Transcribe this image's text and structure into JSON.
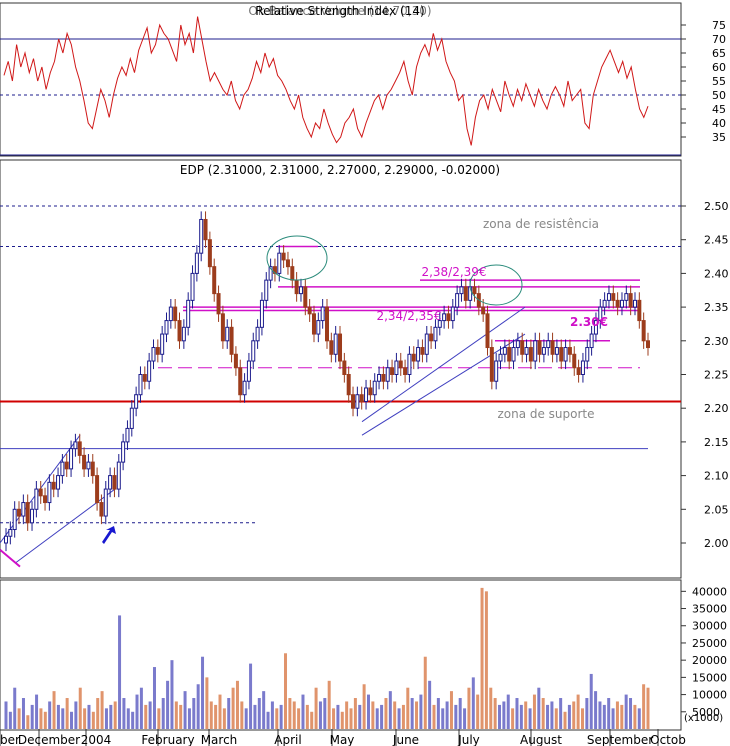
{
  "chart_data": [
    {
      "type": "line",
      "panel": "rsi",
      "title": "Relative Strength Index (14)",
      "overlap_title": "Ok Balance Volume (14,70,30)",
      "ylim": [
        30,
        80
      ],
      "yticks": [
        35,
        40,
        45,
        50,
        55,
        60,
        65,
        70,
        75
      ],
      "levels": {
        "upper": 70,
        "lower": 30,
        "mid": 50
      },
      "color": "#d01818",
      "series": [
        {
          "values": [
            57,
            62,
            55,
            68,
            60,
            65,
            58,
            63,
            55,
            60,
            52,
            58,
            62,
            70,
            65,
            72,
            68,
            60,
            55,
            48,
            40,
            38,
            45,
            52,
            48,
            42,
            50,
            56,
            60,
            57,
            63,
            58,
            66,
            70,
            74,
            65,
            68,
            75,
            72,
            70,
            66,
            62,
            75,
            68,
            72,
            65,
            78,
            70,
            62,
            55,
            58,
            55,
            52,
            50,
            55,
            48,
            45,
            50,
            52,
            56,
            62,
            58,
            65,
            60,
            63,
            57,
            55,
            52,
            48,
            45,
            50,
            42,
            38,
            35,
            40,
            38,
            45,
            40,
            36,
            33,
            35,
            40,
            42,
            45,
            38,
            35,
            40,
            44,
            48,
            50,
            45,
            50,
            52,
            55,
            58,
            62,
            55,
            50,
            60,
            65,
            68,
            64,
            72,
            66,
            70,
            62,
            58,
            55,
            48,
            50,
            38,
            32,
            42,
            48,
            50,
            45,
            52,
            48,
            44,
            55,
            50,
            46,
            52,
            48,
            54,
            50,
            46,
            52,
            48,
            45,
            50,
            53,
            50,
            46,
            55,
            48,
            50,
            52,
            40,
            38,
            50,
            55,
            60,
            63,
            66,
            62,
            58,
            62,
            56,
            60,
            52,
            45,
            42,
            46
          ]
        }
      ]
    },
    {
      "type": "candlestick",
      "panel": "price",
      "title": "EDP (2.31000, 2.31000, 2.27000, 2.29000, -0.02000)",
      "ylim": [
        1.94,
        2.56
      ],
      "yticks": [
        "2.00",
        "2.05",
        "2.10",
        "2.15",
        "2.20",
        "2.25",
        "2.30",
        "2.35",
        "2.40",
        "2.45",
        "2.50"
      ],
      "close": [
        2.01,
        2.02,
        2.05,
        2.04,
        2.06,
        2.03,
        2.05,
        2.08,
        2.07,
        2.06,
        2.09,
        2.08,
        2.1,
        2.12,
        2.11,
        2.14,
        2.15,
        2.13,
        2.11,
        2.12,
        2.1,
        2.06,
        2.04,
        2.08,
        2.1,
        2.08,
        2.12,
        2.15,
        2.17,
        2.2,
        2.22,
        2.25,
        2.24,
        2.27,
        2.29,
        2.28,
        2.31,
        2.33,
        2.35,
        2.33,
        2.3,
        2.32,
        2.36,
        2.4,
        2.43,
        2.48,
        2.45,
        2.41,
        2.37,
        2.34,
        2.3,
        2.32,
        2.28,
        2.26,
        2.22,
        2.24,
        2.27,
        2.3,
        2.32,
        2.36,
        2.39,
        2.41,
        2.4,
        2.43,
        2.42,
        2.41,
        2.39,
        2.37,
        2.38,
        2.35,
        2.34,
        2.31,
        2.33,
        2.35,
        2.3,
        2.28,
        2.31,
        2.27,
        2.25,
        2.22,
        2.2,
        2.22,
        2.21,
        2.23,
        2.22,
        2.24,
        2.25,
        2.24,
        2.26,
        2.25,
        2.27,
        2.26,
        2.25,
        2.28,
        2.27,
        2.29,
        2.28,
        2.31,
        2.3,
        2.32,
        2.33,
        2.34,
        2.33,
        2.35,
        2.37,
        2.38,
        2.36,
        2.38,
        2.37,
        2.35,
        2.34,
        2.29,
        2.24,
        2.27,
        2.28,
        2.29,
        2.27,
        2.29,
        2.3,
        2.28,
        2.29,
        2.27,
        2.3,
        2.28,
        2.29,
        2.3,
        2.28,
        2.29,
        2.27,
        2.29,
        2.28,
        2.26,
        2.25,
        2.27,
        2.29,
        2.31,
        2.33,
        2.35,
        2.36,
        2.37,
        2.36,
        2.35,
        2.36,
        2.37,
        2.35,
        2.36,
        2.33,
        2.3,
        2.29
      ],
      "color_up": "#1c1c8c",
      "color_down": "#9c3c1c",
      "annotations": [
        {
          "text": "zona de resistência",
          "color": "#888888"
        },
        {
          "text": "2,38/2,39€",
          "color": "#d010c8"
        },
        {
          "text": "2,34/2,35€",
          "color": "#d010c8"
        },
        {
          "text": "2.30€",
          "color": "#d010c8"
        },
        {
          "text": "zona de suporte",
          "color": "#888888"
        }
      ],
      "levels": [
        {
          "y": 2.5,
          "style": "dashed",
          "color": "#1c1c8c"
        },
        {
          "y": 2.44,
          "style": "dashed",
          "color": "#1c1c8c"
        },
        {
          "y": 2.21,
          "style": "solid",
          "color": "#d00000"
        },
        {
          "y": 2.14,
          "style": "solid",
          "color": "#4040c0"
        },
        {
          "y": 2.26,
          "style": "dashed",
          "color": "#d010c8"
        },
        {
          "y": 2.03,
          "style": "dotted",
          "color": "#1c1c8c"
        }
      ]
    },
    {
      "type": "bar",
      "panel": "volume",
      "ylim": [
        0,
        43000
      ],
      "yticks": [
        "5000",
        "10000",
        "15000",
        "20000",
        "25000",
        "30000",
        "35000",
        "40000"
      ],
      "unit": "(x1000)",
      "colors": {
        "up": "#7a7acc",
        "down": "#e0946c"
      },
      "values": [
        8000,
        5000,
        12000,
        6000,
        9000,
        4000,
        7000,
        10000,
        6000,
        5000,
        8000,
        11000,
        7000,
        6000,
        9000,
        5000,
        8000,
        12000,
        6000,
        7000,
        5000,
        9000,
        11000,
        6000,
        7000,
        8000,
        33000,
        9000,
        6000,
        5000,
        10000,
        12000,
        7000,
        8000,
        18000,
        6000,
        9000,
        14000,
        20000,
        8000,
        7000,
        11000,
        6000,
        9000,
        13000,
        21000,
        15000,
        8000,
        7000,
        10000,
        6000,
        9000,
        12000,
        14000,
        8000,
        6000,
        19000,
        7000,
        9000,
        11000,
        5000,
        8000,
        6000,
        7000,
        22000,
        9000,
        8000,
        6000,
        10000,
        7000,
        5000,
        12000,
        8000,
        9000,
        14000,
        6000,
        7000,
        5000,
        8000,
        6000,
        9000,
        7000,
        13000,
        10000,
        8000,
        6000,
        7000,
        9000,
        11000,
        8000,
        6000,
        7000,
        12000,
        9000,
        8000,
        10000,
        21000,
        14000,
        7000,
        9000,
        6000,
        8000,
        11000,
        7000,
        9000,
        6000,
        12000,
        15000,
        10000,
        41000,
        40000,
        12000,
        9000,
        7000,
        8000,
        10000,
        6000,
        9000,
        7000,
        8000,
        6000,
        10000,
        12000,
        9000,
        7000,
        8000,
        6000,
        9000,
        5000,
        7000,
        8000,
        10000,
        6000,
        9000,
        16000,
        11000,
        8000,
        7000,
        9000,
        6000,
        8000,
        7000,
        10000,
        9000,
        7000,
        6000,
        13000,
        12000
      ]
    }
  ],
  "x_axis": {
    "months": [
      "ber",
      "December",
      "2004",
      "February",
      "March",
      "April",
      "May",
      "June",
      "July",
      "August",
      "September",
      "Octob"
    ]
  }
}
